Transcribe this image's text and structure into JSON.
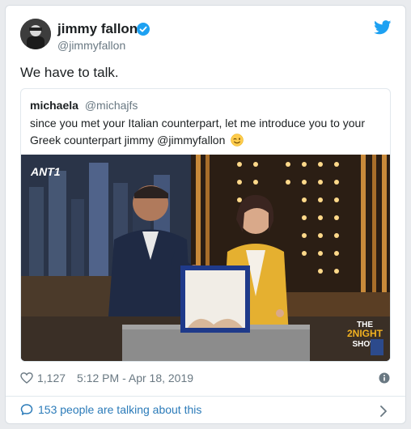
{
  "author": {
    "name": "jimmy fallon",
    "handle": "@jimmyfallon",
    "verified": true
  },
  "tweet": {
    "text": "We have to talk."
  },
  "quoted_tweet": {
    "name": "michaela",
    "handle": "@michajfs",
    "text": "since you met your Italian counterpart, let me introduce you to your Greek counterpart jimmy @jimmyfallon",
    "emoji": "winking-face-emoji",
    "media": {
      "channel_logo": "ANT1",
      "show_logo_line1": "THE",
      "show_logo_line2": "2NIGHT",
      "show_logo_line3": "SHOW"
    }
  },
  "stats": {
    "likes": "1,127",
    "timestamp": "5:12 PM - Apr 18, 2019"
  },
  "footer": {
    "talking": "153 people are talking about this"
  },
  "colors": {
    "link": "#2b7bb9",
    "twitter_blue": "#1da1f2",
    "muted": "#697882",
    "text": "#1c2022"
  }
}
